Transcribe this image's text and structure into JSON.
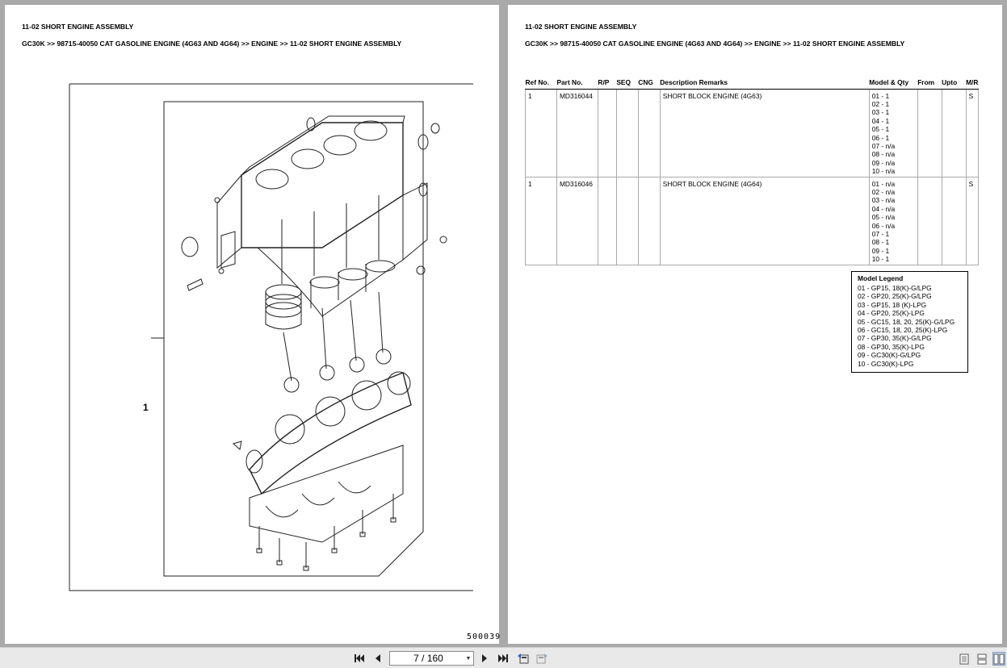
{
  "left_page": {
    "title": "11-02 SHORT ENGINE ASSEMBLY",
    "breadcrumb": "GC30K >> 98715-40050 CAT GASOLINE ENGINE (4G63 AND 4G64) >> ENGINE >> 11-02 SHORT ENGINE ASSEMBLY",
    "drawing": {
      "callout_label": "1",
      "drawing_code": "500039"
    }
  },
  "right_page": {
    "title": "11-02 SHORT ENGINE ASSEMBLY",
    "breadcrumb": "GC30K >> 98715-40050 CAT GASOLINE ENGINE (4G63 AND 4G64) >> ENGINE >> 11-02 SHORT ENGINE ASSEMBLY",
    "table": {
      "headers": [
        "Ref No.",
        "Part No.",
        "R/P",
        "SEQ",
        "CNG",
        "Description Remarks",
        "Model & Qty",
        "From",
        "Upto",
        "M/R"
      ],
      "rows": [
        {
          "ref": "1",
          "part_no": "MD316044",
          "rp": "",
          "seq": "",
          "cng": "",
          "description": "SHORT BLOCK ENGINE (4G63)",
          "model_qty": [
            "01 - 1",
            "02 - 1",
            "03 - 1",
            "04 - 1",
            "05 - 1",
            "06 - 1",
            "07 - n/a",
            "08 - n/a",
            "09 - n/a",
            "10 - n/a"
          ],
          "from": "",
          "upto": "",
          "mr": "S"
        },
        {
          "ref": "1",
          "part_no": "MD316046",
          "rp": "",
          "seq": "",
          "cng": "",
          "description": "SHORT BLOCK ENGINE (4G64)",
          "model_qty": [
            "01 - n/a",
            "02 - n/a",
            "03 - n/a",
            "04 - n/a",
            "05 - n/a",
            "06 - n/a",
            "07 - 1",
            "08 - 1",
            "09 - 1",
            "10 - 1"
          ],
          "from": "",
          "upto": "",
          "mr": "S"
        }
      ]
    },
    "legend": {
      "title": "Model Legend",
      "items": [
        "01 - GP15, 18(K)-G/LPG",
        "02 - GP20, 25(K)-G/LPG",
        "03 - GP15, 18 (K)-LPG",
        "04 - GP20, 25(K)-LPG",
        "05 - GC15, 18, 20, 25(K)-G/LPG",
        "06 - GC15, 18, 20, 25(K)-LPG",
        "07 - GP30, 35(K)-G/LPG",
        "08 - GP30, 35(K)-LPG",
        "09 - GC30(K)-G/LPG",
        "10 - GC30(K)-LPG"
      ]
    }
  },
  "toolbar": {
    "page_indicator": "7 / 160",
    "icons": [
      "first-page-icon",
      "prev-page-icon",
      "next-page-icon",
      "last-page-icon",
      "back-icon",
      "forward-icon",
      "single-page-view-icon",
      "continuous-view-icon",
      "two-page-view-icon"
    ]
  },
  "colors": {
    "background": "#a9a9a9",
    "toolbar": "#e9e9e9",
    "active_view": "#c9d7ea"
  }
}
